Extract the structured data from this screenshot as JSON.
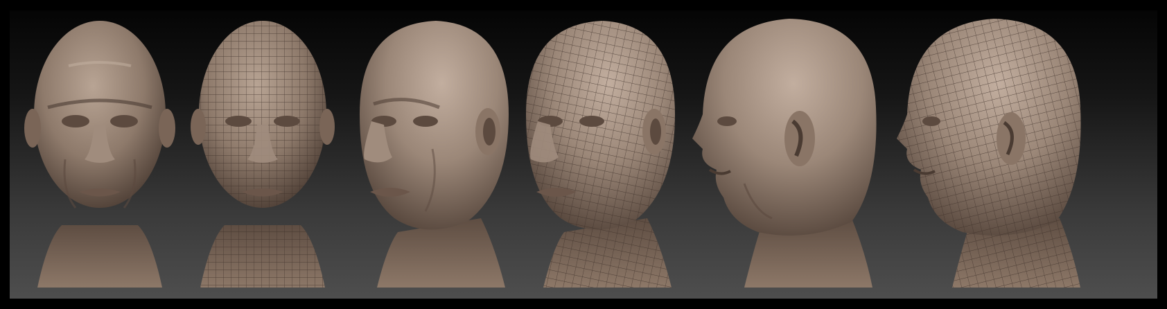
{
  "render": {
    "views": [
      {
        "id": "front-sculpt",
        "view": "front",
        "wireframe": false
      },
      {
        "id": "front-wire",
        "view": "front",
        "wireframe": true
      },
      {
        "id": "three-quarter-sculpt",
        "view": "three-quarter",
        "wireframe": false
      },
      {
        "id": "three-quarter-wire",
        "view": "three-quarter",
        "wireframe": true
      },
      {
        "id": "profile-sculpt",
        "view": "profile",
        "wireframe": false
      },
      {
        "id": "profile-wire",
        "view": "profile",
        "wireframe": true
      }
    ],
    "colors": {
      "border": "#000000",
      "bg_top": "#050505",
      "bg_bottom": "#4e4e4e",
      "clay_light": "#b39f90",
      "clay_mid": "#8a7566",
      "clay_dark": "#4a3b32",
      "wire": "#3a2d26"
    }
  }
}
